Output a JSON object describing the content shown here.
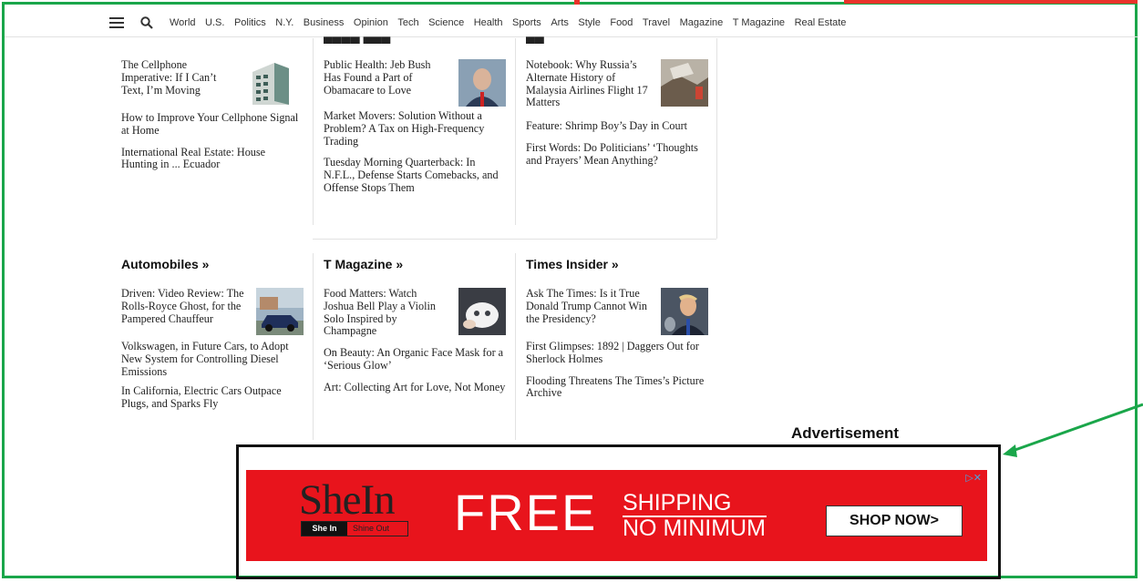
{
  "nav": {
    "items": [
      "World",
      "U.S.",
      "Politics",
      "N.Y.",
      "Business",
      "Opinion",
      "Tech",
      "Science",
      "Health",
      "Sports",
      "Arts",
      "Style",
      "Food",
      "Travel",
      "Magazine",
      "T Magazine",
      "Real Estate"
    ]
  },
  "top_sections": [
    {
      "stories": [
        "The Cellphone Imperative: If I Can’t Text, I’m Moving",
        "How to Improve Your Cellphone Signal at Home",
        "International Real Estate: House Hunting in ... Ecuador"
      ]
    },
    {
      "stories": [
        "Public Health: Jeb Bush Has Found a Part of Obamacare to Love",
        "Market Movers: Solution Without a Problem? A Tax on High-Frequency Trading",
        "Tuesday Morning Quarterback: In N.F.L., Defense Starts Comebacks, and Offense Stops Them"
      ]
    },
    {
      "stories": [
        "Notebook: Why Russia’s Alternate History of Malaysia Airlines Flight 17 Matters",
        "Feature: Shrimp Boy’s Day in Court",
        "First Words: Do Politicians’ ‘Thoughts and Prayers’ Mean Anything?"
      ]
    }
  ],
  "sections": [
    {
      "title": "Automobiles »",
      "stories": [
        "Driven: Video Review: The Rolls-Royce Ghost, for the Pampered Chauffeur",
        "Volkswagen, in Future Cars, to Adopt New System for Controlling Diesel Emissions",
        "In California, Electric Cars Outpace Plugs, and Sparks Fly"
      ]
    },
    {
      "title": "T Magazine »",
      "stories": [
        "Food Matters: Watch Joshua Bell Play a Violin Solo Inspired by Champagne",
        "On Beauty: An Organic Face Mask for a ‘Serious Glow’",
        "Art: Collecting Art for Love, Not Money"
      ]
    },
    {
      "title": "Times Insider »",
      "stories": [
        "Ask The Times: Is it True Donald Trump Cannot Win the Presidency?",
        "First Glimpses: 1892 | Daggers Out for Sherlock Holmes",
        "Flooding Threatens The Times’s Picture Archive"
      ]
    }
  ],
  "ad": {
    "label": "Advertisement",
    "brand": "SheIn",
    "brand_tag_a": "She In",
    "brand_tag_b": "Shine Out",
    "free": "FREE",
    "shipping": "SHIPPING",
    "minimum": "NO MINIMUM",
    "cta": "SHOP NOW>",
    "adchoices": "▷✕"
  },
  "colors": {
    "frame_green": "#1aa64a",
    "frame_red": "#e8332a",
    "ad_red": "#e8141c"
  }
}
